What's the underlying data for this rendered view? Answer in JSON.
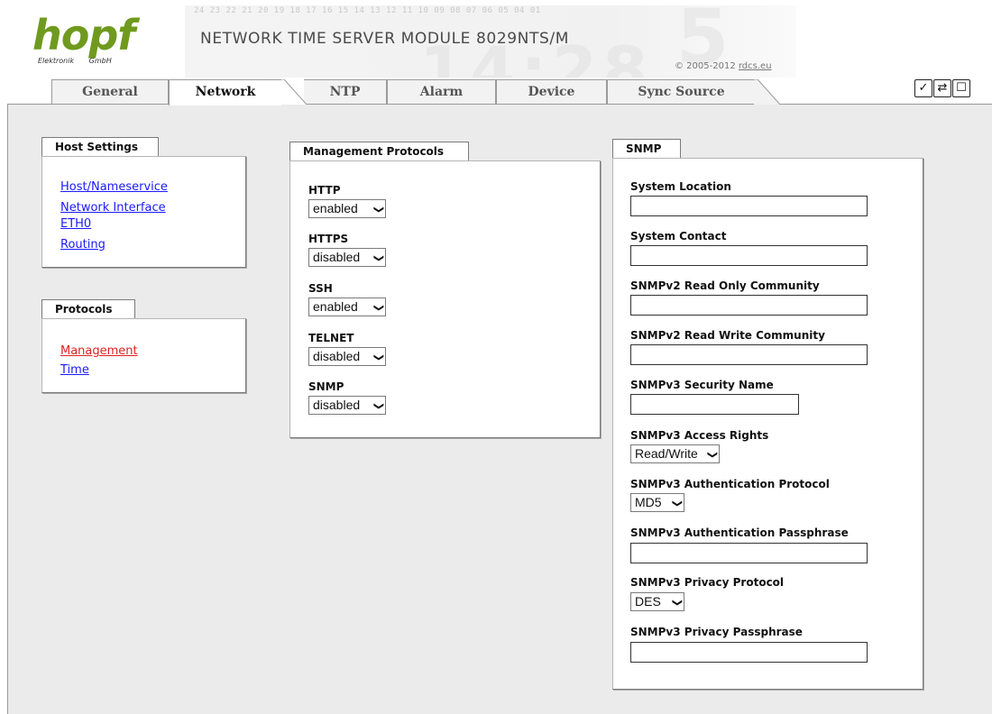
{
  "header": {
    "logo_text": "hopf",
    "logo_sub": "Elektronik GmbH",
    "title": "NETWORK TIME SERVER MODULE 8029NTS/M",
    "banner_digits": "24 23 22 21 20 19 18 17 16 15 14 13 12 11 10 09 08 07 06 05 04 01",
    "banner_clock": "14:28",
    "banner_bignum": "5",
    "copyright": "© 2005-2012",
    "copyright_link": "rdcs.eu"
  },
  "tabs": [
    {
      "label": "General"
    },
    {
      "label": "Network",
      "active": true
    },
    {
      "label": "NTP"
    },
    {
      "label": "Alarm"
    },
    {
      "label": "Device"
    },
    {
      "label": "Sync Source"
    }
  ],
  "toolbar": {
    "icons": [
      "check-icon",
      "refresh-icon",
      "page-icon"
    ],
    "check_glyph": "✓",
    "refresh_glyph": "⇄",
    "page_glyph": "☐"
  },
  "host_settings": {
    "title": "Host Settings",
    "links": [
      "Host/Nameservice",
      "Network Interface",
      "ETH0",
      "Routing"
    ]
  },
  "protocols": {
    "title": "Protocols",
    "links": [
      "Management",
      "Time"
    ],
    "current": "Management"
  },
  "management_protocols": {
    "title": "Management Protocols",
    "fields": [
      {
        "label": "HTTP",
        "value": "enabled"
      },
      {
        "label": "HTTPS",
        "value": "disabled"
      },
      {
        "label": "SSH",
        "value": "enabled"
      },
      {
        "label": "TELNET",
        "value": "disabled"
      },
      {
        "label": "SNMP",
        "value": "disabled"
      }
    ]
  },
  "snmp": {
    "title": "SNMP",
    "system_location": {
      "label": "System Location",
      "value": ""
    },
    "system_contact": {
      "label": "System Contact",
      "value": ""
    },
    "v2_ro": {
      "label": "SNMPv2 Read Only Community",
      "value": ""
    },
    "v2_rw": {
      "label": "SNMPv2 Read Write Community",
      "value": ""
    },
    "v3_security_name": {
      "label": "SNMPv3 Security Name",
      "value": ""
    },
    "v3_access_rights": {
      "label": "SNMPv3 Access Rights",
      "value": "Read/Write"
    },
    "v3_auth_protocol": {
      "label": "SNMPv3 Authentication Protocol",
      "value": "MD5"
    },
    "v3_auth_pass": {
      "label": "SNMPv3 Authentication Passphrase",
      "value": ""
    },
    "v3_priv_protocol": {
      "label": "SNMPv3 Privacy Protocol",
      "value": "DES"
    },
    "v3_priv_pass": {
      "label": "SNMPv3 Privacy Passphrase",
      "value": ""
    }
  }
}
